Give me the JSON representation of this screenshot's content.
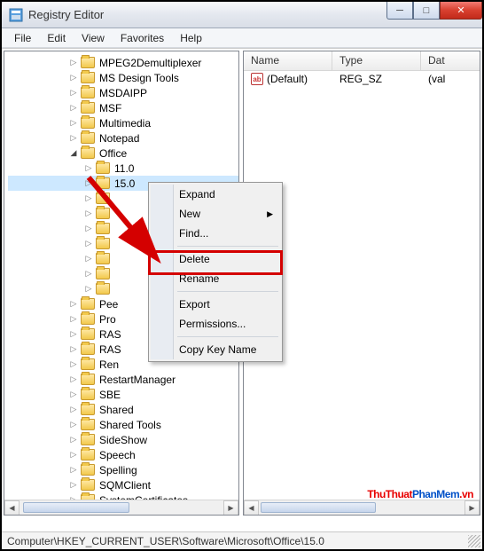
{
  "window": {
    "title": "Registry Editor"
  },
  "menubar": {
    "file": "File",
    "edit": "Edit",
    "view": "View",
    "favorites": "Favorites",
    "help": "Help"
  },
  "tree": {
    "items": [
      {
        "indent": 4,
        "exp": "closed",
        "label": "MPEG2Demultiplexer"
      },
      {
        "indent": 4,
        "exp": "closed",
        "label": "MS Design Tools"
      },
      {
        "indent": 4,
        "exp": "closed",
        "label": "MSDAIPP"
      },
      {
        "indent": 4,
        "exp": "closed",
        "label": "MSF"
      },
      {
        "indent": 4,
        "exp": "closed",
        "label": "Multimedia"
      },
      {
        "indent": 4,
        "exp": "closed",
        "label": "Notepad"
      },
      {
        "indent": 4,
        "exp": "open",
        "label": "Office"
      },
      {
        "indent": 5,
        "exp": "closed",
        "label": "11.0"
      },
      {
        "indent": 5,
        "exp": "closed",
        "label": "15.0",
        "sel": true
      },
      {
        "indent": 5,
        "exp": "closed",
        "label": ""
      },
      {
        "indent": 5,
        "exp": "closed",
        "label": ""
      },
      {
        "indent": 5,
        "exp": "closed",
        "label": ""
      },
      {
        "indent": 5,
        "exp": "closed",
        "label": ""
      },
      {
        "indent": 5,
        "exp": "closed",
        "label": ""
      },
      {
        "indent": 5,
        "exp": "closed",
        "label": ""
      },
      {
        "indent": 5,
        "exp": "closed",
        "label": ""
      },
      {
        "indent": 4,
        "exp": "closed",
        "label": "Pee"
      },
      {
        "indent": 4,
        "exp": "closed",
        "label": "Pro"
      },
      {
        "indent": 4,
        "exp": "closed",
        "label": "RAS"
      },
      {
        "indent": 4,
        "exp": "closed",
        "label": "RAS"
      },
      {
        "indent": 4,
        "exp": "closed",
        "label": "Ren"
      },
      {
        "indent": 4,
        "exp": "closed",
        "label": "RestartManager"
      },
      {
        "indent": 4,
        "exp": "closed",
        "label": "SBE"
      },
      {
        "indent": 4,
        "exp": "closed",
        "label": "Shared"
      },
      {
        "indent": 4,
        "exp": "closed",
        "label": "Shared Tools"
      },
      {
        "indent": 4,
        "exp": "closed",
        "label": "SideShow"
      },
      {
        "indent": 4,
        "exp": "closed",
        "label": "Speech"
      },
      {
        "indent": 4,
        "exp": "closed",
        "label": "Spelling"
      },
      {
        "indent": 4,
        "exp": "closed",
        "label": "SQMClient"
      },
      {
        "indent": 4,
        "exp": "closed",
        "label": "SystemCertificates"
      }
    ]
  },
  "columns": {
    "name": "Name",
    "type": "Type",
    "data": "Dat"
  },
  "values": {
    "default_name": "(Default)",
    "default_type": "REG_SZ",
    "default_data": "(val"
  },
  "context_menu": {
    "expand": "Expand",
    "new": "New",
    "find": "Find...",
    "delete": "Delete",
    "rename": "Rename",
    "export": "Export",
    "permissions": "Permissions...",
    "copy_key_name": "Copy Key Name"
  },
  "statusbar": {
    "path": "Computer\\HKEY_CURRENT_USER\\Software\\Microsoft\\Office\\15.0"
  },
  "watermark": {
    "part1": "ThuThuat",
    "part2": "PhanMem",
    "part3": ".vn"
  }
}
